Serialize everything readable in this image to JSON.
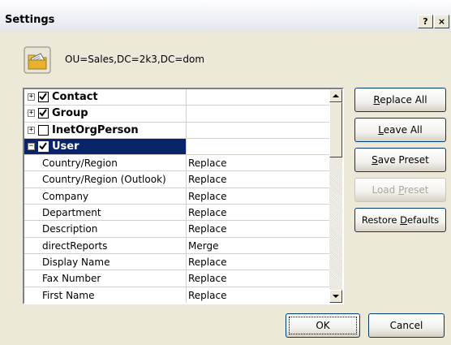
{
  "window": {
    "title": "Settings",
    "help_glyph": "?",
    "close_glyph": "×"
  },
  "header": {
    "icon": "address-book-icon",
    "ou_label": "OU=Sales,DC=2k3,DC=dom"
  },
  "tree": {
    "groups": [
      {
        "label": "Contact",
        "expanded": false,
        "checked": true
      },
      {
        "label": "Group",
        "expanded": false,
        "checked": true
      },
      {
        "label": "InetOrgPerson",
        "expanded": false,
        "checked": false
      },
      {
        "label": "User",
        "expanded": true,
        "checked": true,
        "selected": true
      }
    ],
    "user_properties": [
      {
        "name": "Country/Region",
        "action": "Replace"
      },
      {
        "name": "Country/Region (Outlook)",
        "action": "Replace"
      },
      {
        "name": "Company",
        "action": "Replace"
      },
      {
        "name": "Department",
        "action": "Replace"
      },
      {
        "name": "Description",
        "action": "Replace"
      },
      {
        "name": "directReports",
        "action": "Merge"
      },
      {
        "name": "Display Name",
        "action": "Replace"
      },
      {
        "name": "Fax Number",
        "action": "Replace"
      },
      {
        "name": "First Name",
        "action": "Replace"
      }
    ]
  },
  "buttons": {
    "replace_all": {
      "label": "Replace All",
      "accel": "R",
      "rest": "eplace All"
    },
    "leave_all": {
      "label": "Leave All",
      "accel": "L",
      "rest": "eave All"
    },
    "save_preset": {
      "label": "Save Preset",
      "accel": "S",
      "rest": "ave Preset"
    },
    "load_preset": {
      "label": "Load Preset",
      "pre": "Load ",
      "accel": "P",
      "rest": "reset",
      "disabled": true
    },
    "restore_defaults": {
      "label": "Restore Defaults",
      "pre": "Restore ",
      "accel": "D",
      "rest": "efaults"
    },
    "ok": {
      "label": "OK"
    },
    "cancel": {
      "label": "Cancel"
    }
  }
}
